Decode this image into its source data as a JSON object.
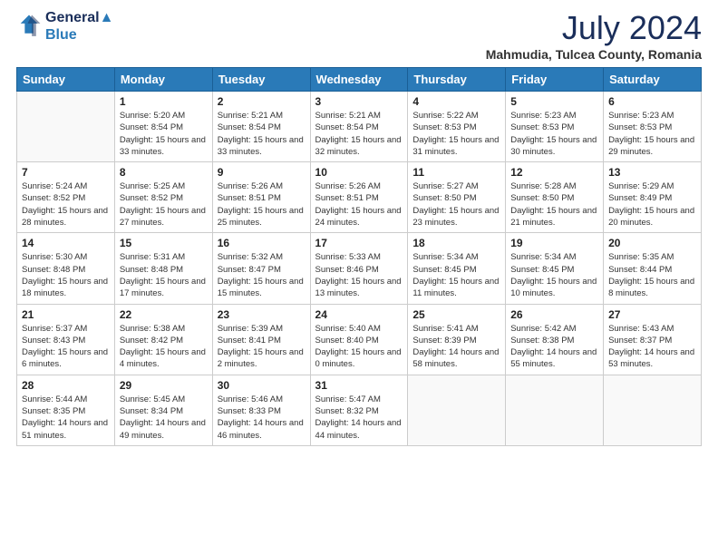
{
  "header": {
    "logo_line1": "General",
    "logo_line2": "Blue",
    "month_title": "July 2024",
    "location": "Mahmudia, Tulcea County, Romania"
  },
  "weekdays": [
    "Sunday",
    "Monday",
    "Tuesday",
    "Wednesday",
    "Thursday",
    "Friday",
    "Saturday"
  ],
  "weeks": [
    [
      {
        "day": null
      },
      {
        "day": 1,
        "sunrise": "5:20 AM",
        "sunset": "8:54 PM",
        "daylight": "15 hours and 33 minutes."
      },
      {
        "day": 2,
        "sunrise": "5:21 AM",
        "sunset": "8:54 PM",
        "daylight": "15 hours and 33 minutes."
      },
      {
        "day": 3,
        "sunrise": "5:21 AM",
        "sunset": "8:54 PM",
        "daylight": "15 hours and 32 minutes."
      },
      {
        "day": 4,
        "sunrise": "5:22 AM",
        "sunset": "8:53 PM",
        "daylight": "15 hours and 31 minutes."
      },
      {
        "day": 5,
        "sunrise": "5:23 AM",
        "sunset": "8:53 PM",
        "daylight": "15 hours and 30 minutes."
      },
      {
        "day": 6,
        "sunrise": "5:23 AM",
        "sunset": "8:53 PM",
        "daylight": "15 hours and 29 minutes."
      }
    ],
    [
      {
        "day": 7,
        "sunrise": "5:24 AM",
        "sunset": "8:52 PM",
        "daylight": "15 hours and 28 minutes."
      },
      {
        "day": 8,
        "sunrise": "5:25 AM",
        "sunset": "8:52 PM",
        "daylight": "15 hours and 27 minutes."
      },
      {
        "day": 9,
        "sunrise": "5:26 AM",
        "sunset": "8:51 PM",
        "daylight": "15 hours and 25 minutes."
      },
      {
        "day": 10,
        "sunrise": "5:26 AM",
        "sunset": "8:51 PM",
        "daylight": "15 hours and 24 minutes."
      },
      {
        "day": 11,
        "sunrise": "5:27 AM",
        "sunset": "8:50 PM",
        "daylight": "15 hours and 23 minutes."
      },
      {
        "day": 12,
        "sunrise": "5:28 AM",
        "sunset": "8:50 PM",
        "daylight": "15 hours and 21 minutes."
      },
      {
        "day": 13,
        "sunrise": "5:29 AM",
        "sunset": "8:49 PM",
        "daylight": "15 hours and 20 minutes."
      }
    ],
    [
      {
        "day": 14,
        "sunrise": "5:30 AM",
        "sunset": "8:48 PM",
        "daylight": "15 hours and 18 minutes."
      },
      {
        "day": 15,
        "sunrise": "5:31 AM",
        "sunset": "8:48 PM",
        "daylight": "15 hours and 17 minutes."
      },
      {
        "day": 16,
        "sunrise": "5:32 AM",
        "sunset": "8:47 PM",
        "daylight": "15 hours and 15 minutes."
      },
      {
        "day": 17,
        "sunrise": "5:33 AM",
        "sunset": "8:46 PM",
        "daylight": "15 hours and 13 minutes."
      },
      {
        "day": 18,
        "sunrise": "5:34 AM",
        "sunset": "8:45 PM",
        "daylight": "15 hours and 11 minutes."
      },
      {
        "day": 19,
        "sunrise": "5:34 AM",
        "sunset": "8:45 PM",
        "daylight": "15 hours and 10 minutes."
      },
      {
        "day": 20,
        "sunrise": "5:35 AM",
        "sunset": "8:44 PM",
        "daylight": "15 hours and 8 minutes."
      }
    ],
    [
      {
        "day": 21,
        "sunrise": "5:37 AM",
        "sunset": "8:43 PM",
        "daylight": "15 hours and 6 minutes."
      },
      {
        "day": 22,
        "sunrise": "5:38 AM",
        "sunset": "8:42 PM",
        "daylight": "15 hours and 4 minutes."
      },
      {
        "day": 23,
        "sunrise": "5:39 AM",
        "sunset": "8:41 PM",
        "daylight": "15 hours and 2 minutes."
      },
      {
        "day": 24,
        "sunrise": "5:40 AM",
        "sunset": "8:40 PM",
        "daylight": "15 hours and 0 minutes."
      },
      {
        "day": 25,
        "sunrise": "5:41 AM",
        "sunset": "8:39 PM",
        "daylight": "14 hours and 58 minutes."
      },
      {
        "day": 26,
        "sunrise": "5:42 AM",
        "sunset": "8:38 PM",
        "daylight": "14 hours and 55 minutes."
      },
      {
        "day": 27,
        "sunrise": "5:43 AM",
        "sunset": "8:37 PM",
        "daylight": "14 hours and 53 minutes."
      }
    ],
    [
      {
        "day": 28,
        "sunrise": "5:44 AM",
        "sunset": "8:35 PM",
        "daylight": "14 hours and 51 minutes."
      },
      {
        "day": 29,
        "sunrise": "5:45 AM",
        "sunset": "8:34 PM",
        "daylight": "14 hours and 49 minutes."
      },
      {
        "day": 30,
        "sunrise": "5:46 AM",
        "sunset": "8:33 PM",
        "daylight": "14 hours and 46 minutes."
      },
      {
        "day": 31,
        "sunrise": "5:47 AM",
        "sunset": "8:32 PM",
        "daylight": "14 hours and 44 minutes."
      },
      {
        "day": null
      },
      {
        "day": null
      },
      {
        "day": null
      }
    ]
  ]
}
